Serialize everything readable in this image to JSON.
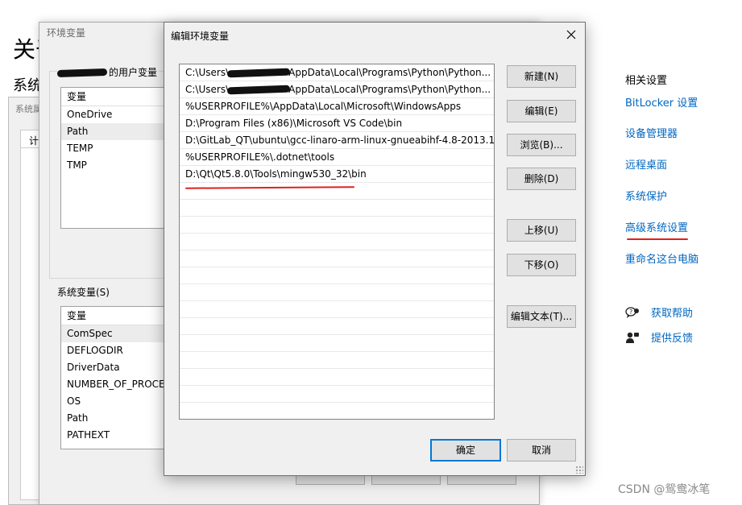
{
  "settings_page": {
    "title_partial": "关于",
    "subtitle_partial": "系统",
    "related_heading": "相关设置",
    "links": [
      "BitLocker 设置",
      "设备管理器",
      "远程桌面",
      "系统保护",
      "高级系统设置",
      "重命名这台电脑"
    ],
    "help_links": [
      {
        "icon": "help-chat-icon",
        "label": "获取帮助"
      },
      {
        "icon": "feedback-icon",
        "label": "提供反馈"
      }
    ]
  },
  "system_properties": {
    "title_partial": "系统属",
    "tab_partial": "计算"
  },
  "env_vars_window": {
    "title": "环境变量",
    "user_vars_label": "的用户变量",
    "user_vars": {
      "header": "变量",
      "rows": [
        "OneDrive",
        "Path",
        "TEMP",
        "TMP"
      ],
      "selected_index": 1
    },
    "system_vars_label": "系统变量(S)",
    "system_vars": {
      "header": "变量",
      "rows": [
        "ComSpec",
        "DEFLOGDIR",
        "DriverData",
        "NUMBER_OF_PROCE",
        "OS",
        "Path",
        "PATHEXT"
      ],
      "selected_index": 0
    }
  },
  "edit_dialog": {
    "title": "编辑环境变量",
    "paths": [
      {
        "pre": "C:\\Users\\",
        "redacted": true,
        "post": "AppData\\Local\\Programs\\Python\\Python..."
      },
      {
        "pre": "C:\\Users\\",
        "redacted": true,
        "post": "AppData\\Local\\Programs\\Python\\Python..."
      },
      {
        "pre": "%USERPROFILE%\\AppData\\Local\\Microsoft\\WindowsApps",
        "redacted": false,
        "post": ""
      },
      {
        "pre": "D:\\Program Files (x86)\\Microsoft VS Code\\bin",
        "redacted": false,
        "post": ""
      },
      {
        "pre": "D:\\GitLab_QT\\ubuntu\\gcc-linaro-arm-linux-gnueabihf-4.8-2013.1...",
        "redacted": false,
        "post": ""
      },
      {
        "pre": "%USERPROFILE%\\.dotnet\\tools",
        "redacted": false,
        "post": ""
      },
      {
        "pre": "D:\\Qt\\Qt5.8.0\\Tools\\mingw530_32\\bin",
        "redacted": false,
        "post": ""
      }
    ],
    "buttons": {
      "new": "新建(N)",
      "edit": "编辑(E)",
      "browse": "浏览(B)...",
      "delete": "删除(D)",
      "move_up": "上移(U)",
      "move_down": "下移(O)",
      "edit_text": "编辑文本(T)...",
      "ok": "确定",
      "cancel": "取消"
    }
  },
  "watermark": "CSDN @鸳鸯冰笔",
  "colors": {
    "link": "#0067c0",
    "annotation_red": "#e02020",
    "primary_border": "#0078d7"
  }
}
